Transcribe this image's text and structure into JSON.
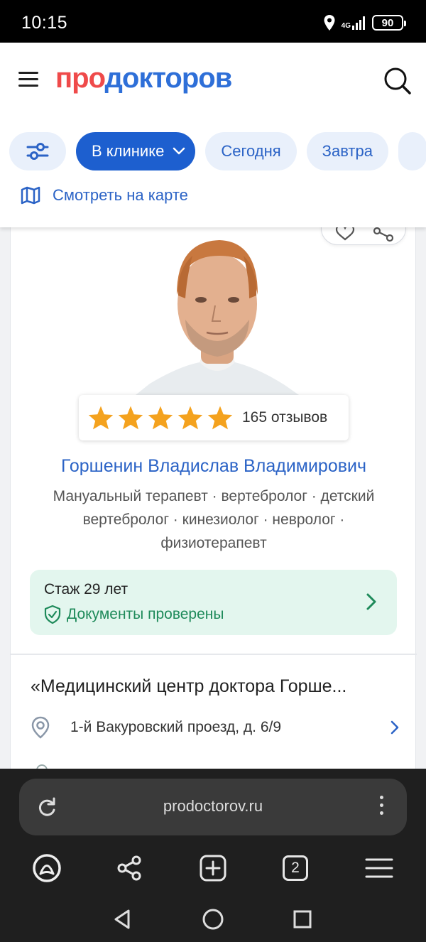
{
  "status_bar": {
    "time": "10:15",
    "network": "4G",
    "battery": "90"
  },
  "header": {
    "logo_part1": "про",
    "logo_part2": "докторов",
    "chips": [
      "В клинике",
      "Сегодня",
      "Завтра"
    ],
    "map_link": "Смотреть на карте"
  },
  "doctor": {
    "rating_stars": 5,
    "reviews": "165 отзывов",
    "name": "Горшенин Владислав Владимирович",
    "specialties": "Мануальный терапевт · вертебролог · детский вертебролог · кинезиолог · невролог · физиотерапевт",
    "experience": "Стаж 29 лет",
    "documents": "Документы проверены"
  },
  "clinic": {
    "name": "«Медицинский центр доктора Горше...",
    "address": "1-й Вакуровский проезд, д. 6/9"
  },
  "browser": {
    "url": "prodoctorov.ru",
    "tabs_count": "2"
  },
  "colors": {
    "brand_red": "#ef4a4a",
    "brand_blue": "#2e6fd8",
    "link_blue": "#2b63c6",
    "chip_active": "#1d5fcf",
    "chip_bg": "#e9f0fb",
    "star": "#f4a21e",
    "verified_green": "#1e8a5a",
    "verified_bg": "#e3f6ee"
  },
  "icons": [
    "location-icon",
    "signal-icon",
    "menu-icon",
    "search-icon",
    "filter-icon",
    "chevron-down-icon",
    "map-icon",
    "heart-icon",
    "share-icon",
    "star-icon",
    "shield-check-icon",
    "chevron-right-icon",
    "pin-icon",
    "reload-icon",
    "more-icon",
    "alice-icon",
    "plus-square-icon",
    "menu-lines-icon",
    "back-icon",
    "home-icon",
    "recents-icon"
  ]
}
